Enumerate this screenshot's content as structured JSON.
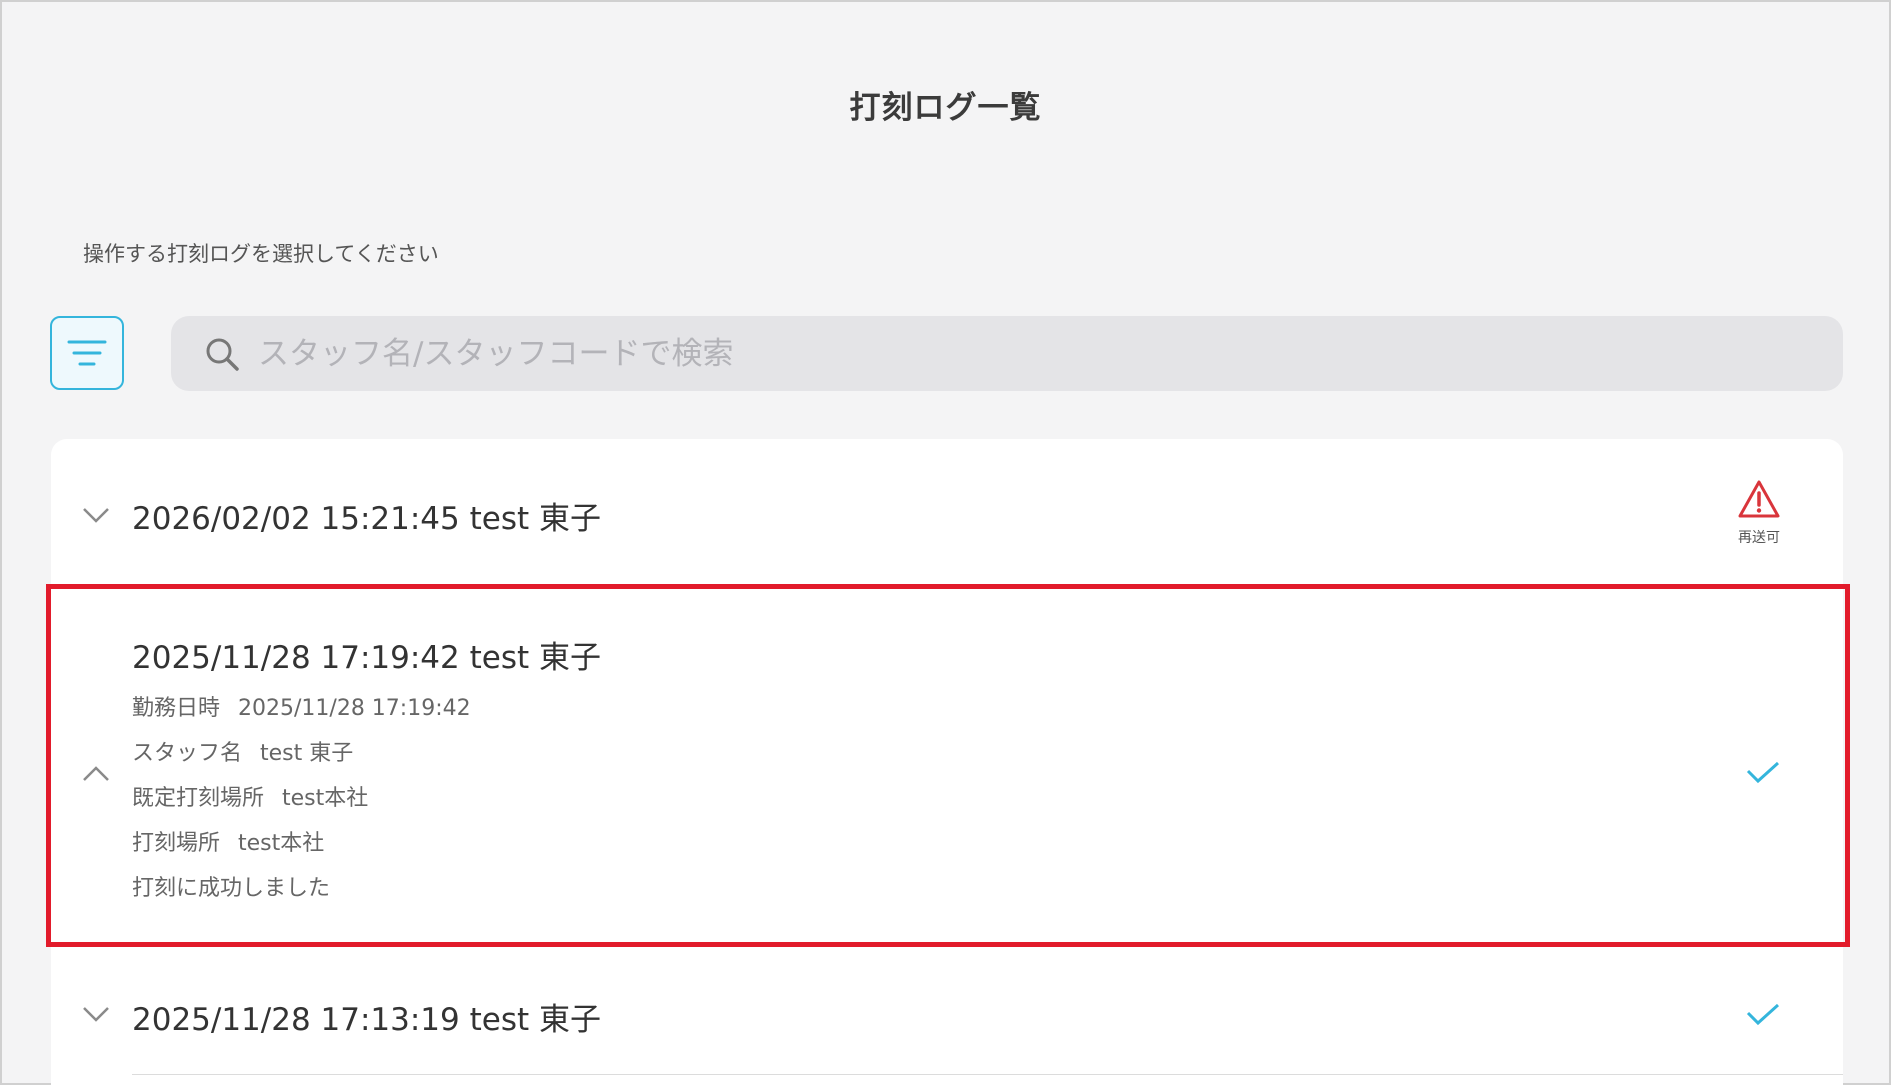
{
  "page": {
    "title": "打刻ログ一覧",
    "instruction": "操作する打刻ログを選択してください"
  },
  "search": {
    "placeholder": "スタッフ名/スタッフコードで検索",
    "value": ""
  },
  "icons": {
    "filter": "filter-icon",
    "search": "search-icon",
    "expand": "chevron-down-icon",
    "collapse": "chevron-up-icon",
    "warning": "warning-icon",
    "success": "check-icon"
  },
  "colors": {
    "accent": "#34b5dc",
    "warning": "#d9353b",
    "highlight": "#e21b2b"
  },
  "logs": [
    {
      "title": "2026/02/02 15:21:45 test 東子",
      "expanded": false,
      "status": "warning",
      "status_label": "再送可"
    },
    {
      "title": "2025/11/28 17:19:42 test 東子",
      "expanded": true,
      "status": "success",
      "details": {
        "work_datetime_label": "勤務日時",
        "work_datetime_value": "2025/11/28 17:19:42",
        "staff_name_label": "スタッフ名",
        "staff_name_value": "test 東子",
        "default_location_label": "既定打刻場所",
        "default_location_value": "test本社",
        "location_label": "打刻場所",
        "location_value": "test本社",
        "message": "打刻に成功しました"
      }
    },
    {
      "title": "2025/11/28 17:13:19 test 東子",
      "expanded": false,
      "status": "success"
    }
  ]
}
